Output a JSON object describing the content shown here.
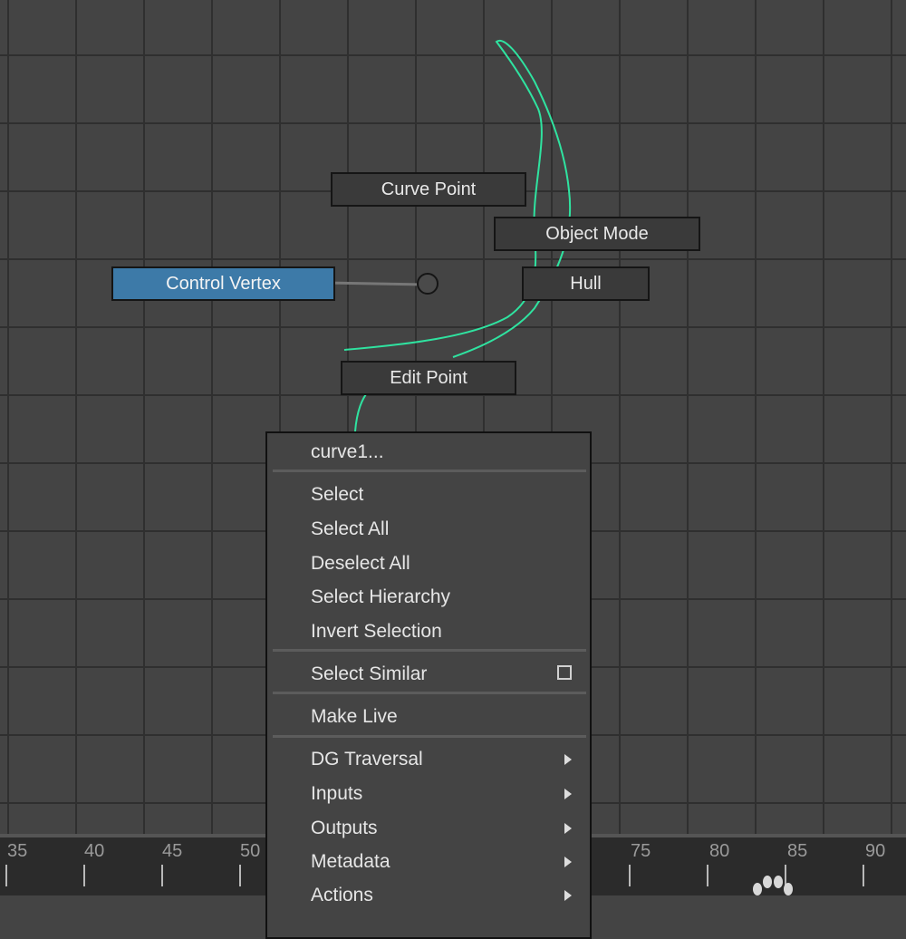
{
  "marking_menu": {
    "north_label": "Curve Point",
    "north_east_label": "Object Mode",
    "east_label": "Hull",
    "west_label": "Control Vertex",
    "south_label": "Edit Point"
  },
  "context_menu": {
    "title": "curve1...",
    "items": [
      {
        "label": "Select"
      },
      {
        "label": "Select All"
      },
      {
        "label": "Deselect All"
      },
      {
        "label": "Select Hierarchy"
      },
      {
        "label": "Invert Selection"
      },
      {
        "label": "Select Similar",
        "option_box": true
      },
      {
        "label": "Make Live"
      },
      {
        "label": "DG Traversal",
        "submenu": true
      },
      {
        "label": "Inputs",
        "submenu": true
      },
      {
        "label": "Outputs",
        "submenu": true
      },
      {
        "label": "Metadata",
        "submenu": true
      },
      {
        "label": "Actions",
        "submenu": true
      }
    ]
  },
  "timeline": {
    "ticks": [
      "35",
      "40",
      "45",
      "50",
      "75",
      "80",
      "85",
      "90"
    ]
  },
  "colors": {
    "curve": "#2fe3a0",
    "active_item": "#3d7aa8",
    "range_marker": "#2fd85a"
  },
  "icons": {
    "paw": "paw-icon",
    "submenu": "triangle-right-icon",
    "option": "option-box-icon"
  }
}
